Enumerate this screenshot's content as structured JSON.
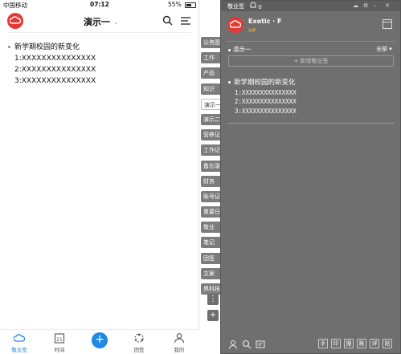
{
  "phone": {
    "status": {
      "carrier": "中国移动",
      "time": "07:12",
      "battery": "55%"
    },
    "header": {
      "title": "演示一",
      "tail": "ˏ"
    },
    "note": {
      "title": "新学期校园的新变化",
      "lines": [
        "1:XXXXXXXXXXXXXXX",
        "2:XXXXXXXXXXXXXXX",
        "3:XXXXXXXXXXXXXXX"
      ]
    },
    "tabs": [
      "公务图",
      "工作",
      "产品",
      "知识",
      "演示二",
      "演示二",
      "营养记",
      "工作记",
      "备忘录",
      "财务",
      "账号记",
      "重要日",
      "敬业",
      "笔记",
      "团签",
      "文案",
      "黑科技"
    ],
    "active_tab": "演示一",
    "tab_more": "⋮",
    "tab_add": "+",
    "nav": [
      {
        "label": "敬业签",
        "icon": "cloud-icon"
      },
      {
        "label": "时间",
        "icon": "calendar-icon"
      },
      {
        "label": "团签",
        "icon": "team-icon"
      },
      {
        "label": "我的",
        "icon": "user-icon"
      }
    ],
    "fab": "+",
    "calendar_day": "21"
  },
  "desktop": {
    "app_name": "敬业签",
    "bell_count": "0",
    "user": "Exotic · F",
    "vip": "VIP",
    "group": "演示一",
    "filter": "全部 ▾",
    "new_button": "+ 新增敬业签",
    "note": {
      "title": "新学期校园的新变化",
      "lines": [
        "1:XXXXXXXXXXXXXXX",
        "2:XXXXXXXXXXXXXXX",
        "3:XXXXXXXXXXXXXXX"
      ]
    },
    "footer_buttons": [
      "手",
      "印",
      "搜",
      "账",
      "详",
      "贴"
    ]
  },
  "colors": {
    "brand_red": "#e53935",
    "accent_blue": "#1e88e5",
    "desk_bg": "#6f6f6f"
  }
}
